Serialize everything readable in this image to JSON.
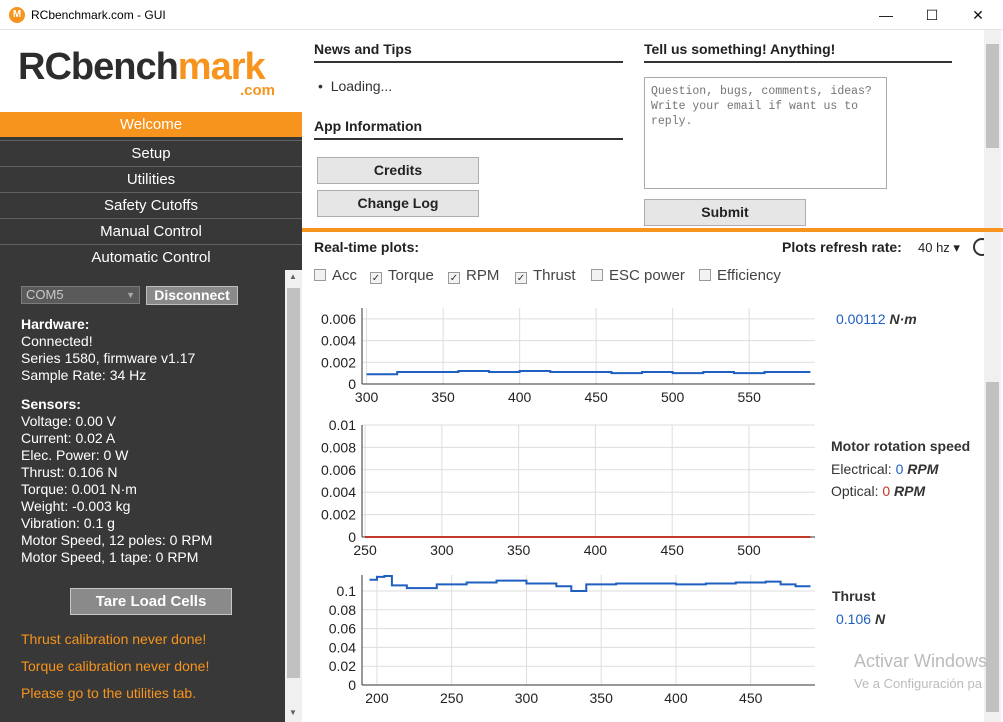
{
  "window": {
    "title": "RCbenchmark.com - GUI",
    "minimize": "—",
    "maximize": "☐",
    "close": "✕"
  },
  "logo": {
    "main_dark": "RCbench",
    "main_orange": "m",
    "main_dark2": "ark",
    "suffix": ".com"
  },
  "nav": [
    {
      "label": "Welcome",
      "active": true
    },
    {
      "label": "Setup"
    },
    {
      "label": "Utilities"
    },
    {
      "label": "Safety Cutoffs"
    },
    {
      "label": "Manual Control"
    },
    {
      "label": "Automatic Control"
    }
  ],
  "sidebar": {
    "port": "COM5",
    "disconnect_label": "Disconnect",
    "hardware": {
      "heading": "Hardware:",
      "lines": [
        "Connected!",
        "Series 1580, firmware v1.17",
        "Sample Rate: 34 Hz"
      ]
    },
    "sensors": {
      "heading": "Sensors:",
      "lines": [
        "Voltage: 0.00 V",
        "Current: 0.02 A",
        "Elec. Power: 0 W",
        "Thrust: 0.106 N",
        "Torque: 0.001 N·m",
        "Weight: -0.003 kg",
        "Vibration: 0.1 g",
        "Motor Speed, 12 poles: 0 RPM",
        "Motor Speed, 1 tape: 0 RPM"
      ]
    },
    "tare_label": "Tare Load Cells",
    "warnings": [
      "Thrust calibration never done!",
      "Torque calibration never done!",
      "Please go to the utilities tab."
    ]
  },
  "news": {
    "title": "News and Tips",
    "item": "Loading..."
  },
  "app_info": {
    "title": "App Information",
    "credits": "Credits",
    "changelog": "Change Log"
  },
  "feedback": {
    "title": "Tell us something! Anything!",
    "placeholder": "Question, bugs, comments, ideas? Write your email if want us to reply.",
    "submit": "Submit"
  },
  "plots": {
    "title": "Real-time plots:",
    "refresh_label": "Plots refresh rate:",
    "refresh_value": "40 hz ▾",
    "checkboxes": [
      {
        "label": "Acc",
        "checked": false
      },
      {
        "label": "Torque",
        "checked": true
      },
      {
        "label": "RPM",
        "checked": true
      },
      {
        "label": "Thrust",
        "checked": true
      },
      {
        "label": "ESC power",
        "checked": false
      },
      {
        "label": "Efficiency",
        "checked": false
      }
    ],
    "torque_readout": {
      "value": "0.00112",
      "unit": "N·m"
    },
    "rpm_readout": {
      "title": "Motor rotation speed",
      "electrical_label": "Electrical:",
      "electrical_value": "0",
      "optical_label": "Optical:",
      "optical_value": "0",
      "unit": "RPM"
    },
    "thrust_readout": {
      "title": "Thrust",
      "value": "0.106",
      "unit": "N"
    }
  },
  "chart_data": [
    {
      "type": "line",
      "title": "Torque",
      "x": [
        300,
        320,
        340,
        360,
        380,
        400,
        420,
        440,
        460,
        480,
        500,
        520,
        540,
        560,
        580,
        590
      ],
      "series": [
        {
          "values": [
            0.0009,
            0.0011,
            0.0011,
            0.0012,
            0.0011,
            0.0012,
            0.0011,
            0.0011,
            0.001,
            0.0011,
            0.001,
            0.0011,
            0.001,
            0.0011,
            0.0011,
            0.0011
          ],
          "color": "#1f5fbf"
        }
      ],
      "xlim": [
        297,
        593
      ],
      "ylim": [
        0,
        0.007
      ],
      "xticks": [
        300,
        350,
        400,
        450,
        500,
        550
      ],
      "yticks": [
        "0",
        "0.002",
        "0.004",
        "0.006"
      ],
      "grid": true
    },
    {
      "type": "line",
      "title": "Motor rotation speed",
      "x": [
        250,
        540
      ],
      "series": [
        {
          "name": "Electrical",
          "values": [
            0,
            0
          ],
          "color": "#1f5fbf"
        },
        {
          "name": "Optical",
          "values": [
            0,
            0
          ],
          "color": "#c0392b"
        }
      ],
      "xlim": [
        248,
        543
      ],
      "ylim": [
        0,
        0.01
      ],
      "xticks": [
        250,
        300,
        350,
        400,
        450,
        500
      ],
      "yticks": [
        "0",
        "0.002",
        "0.004",
        "0.006",
        "0.008",
        "0.01"
      ],
      "grid": true
    },
    {
      "type": "line",
      "title": "Thrust",
      "x": [
        195,
        200,
        205,
        210,
        220,
        240,
        260,
        280,
        300,
        320,
        330,
        340,
        360,
        380,
        400,
        420,
        440,
        460,
        470,
        480,
        490
      ],
      "series": [
        {
          "values": [
            0.112,
            0.115,
            0.116,
            0.106,
            0.103,
            0.107,
            0.109,
            0.111,
            0.108,
            0.105,
            0.1,
            0.107,
            0.108,
            0.108,
            0.107,
            0.108,
            0.109,
            0.11,
            0.107,
            0.105,
            0.105
          ],
          "color": "#1f5fbf"
        }
      ],
      "xlim": [
        190,
        493
      ],
      "ylim": [
        0,
        0.117
      ],
      "xticks": [
        200,
        250,
        300,
        350,
        400,
        450
      ],
      "yticks": [
        "0",
        "0.02",
        "0.04",
        "0.06",
        "0.08",
        "0.1"
      ],
      "grid": true
    }
  ],
  "watermark": {
    "line1": "Activar Windows",
    "line2": "Ve a Configuración pa"
  }
}
